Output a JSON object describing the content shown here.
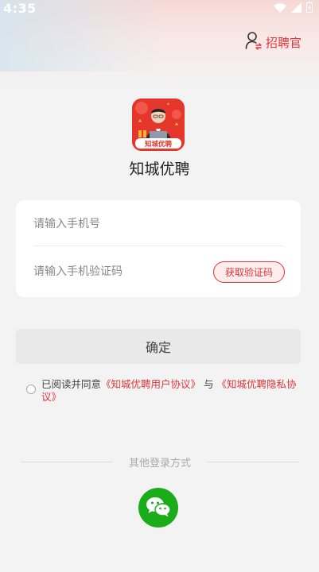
{
  "status_bar": {
    "time": "4:35",
    "icons": [
      "wifi-icon",
      "signal-icon",
      "battery-icon"
    ]
  },
  "header": {
    "recruiter_label": "招聘官",
    "recruiter_icon": "person-switch-icon"
  },
  "app": {
    "logo_text": "知城优聘",
    "name": "知城优聘"
  },
  "form": {
    "phone_placeholder": "请输入手机号",
    "code_placeholder": "请输入手机验证码",
    "get_code_label": "获取验证码",
    "confirm_label": "确定"
  },
  "agreement": {
    "prefix": "已阅读并同意",
    "user_agreement": "《知城优聘用户协议》",
    "connector": "与",
    "privacy_agreement": "《知城优聘隐私协议》"
  },
  "other_login": {
    "label": "其他登录方式",
    "options": [
      "wechat-icon"
    ]
  },
  "colors": {
    "accent": "#e0343a",
    "wechat": "#1aad19",
    "background": "#f3f3f3"
  }
}
